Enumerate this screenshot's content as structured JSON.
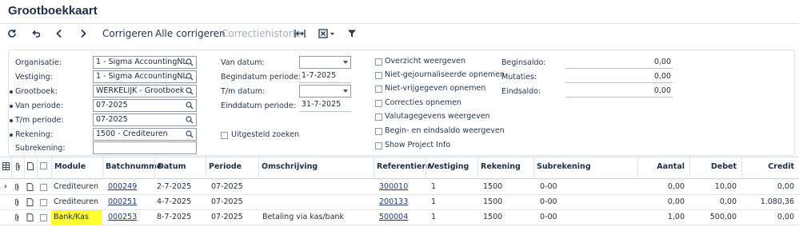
{
  "title": "Grootboekkaart",
  "toolbar": {
    "refresh_icon": "refresh-icon",
    "undo_icon": "undo-icon",
    "prev_icon": "chevron-left-icon",
    "next_icon": "chevron-right-icon",
    "corrigeren": "Corrigeren",
    "alle_corrigeren": "Alle corrigeren",
    "correctiehistorie": "Correctiehistorie",
    "fit_icon": "fit-columns-icon",
    "export_icon": "excel-export-icon",
    "filter_icon": "filter-icon"
  },
  "filter": {
    "organisatie": {
      "label": "Organisatie:",
      "value": "1 - Sigma AccountingNL"
    },
    "vestiging": {
      "label": "Vestiging:",
      "value": "1 - Sigma AccountingNL"
    },
    "grootboek": {
      "label": "Grootboek:",
      "value": "WERKELIJK - Grootboek"
    },
    "van_periode": {
      "label": "Van periode:",
      "value": "07-2025"
    },
    "tm_periode": {
      "label": "T/m periode:",
      "value": "07-2025"
    },
    "rekening": {
      "label": "Rekening:",
      "value": "1500 - Crediteuren"
    },
    "subrekening": {
      "label": "Subrekening:",
      "value": ""
    },
    "van_datum": {
      "label": "Van datum:",
      "value": ""
    },
    "begindatum": {
      "label": "Begindatum periode:",
      "value": "1-7-2025"
    },
    "tm_datum": {
      "label": "T/m datum:",
      "value": ""
    },
    "einddatum": {
      "label": "Einddatum periode:",
      "value": "31-7-2025"
    },
    "uitgesteld": "Uitgesteld zoeken",
    "checks": [
      "Overzicht weergeven",
      "Niet-gejournaliseerde opnemen",
      "Niet-vrijgegeven opnemen",
      "Correcties opnemen",
      "Valutagegevens weergeven",
      "Begin- en eindsaldo weergeven",
      "Show Project Info"
    ],
    "beginsaldo": {
      "label": "Beginsaldo:",
      "value": "0,00"
    },
    "mutaties": {
      "label": "Mutaties:",
      "value": "0,00"
    },
    "eindsaldo": {
      "label": "Eindsaldo:",
      "value": "0,00"
    }
  },
  "grid": {
    "headers": {
      "module": "Module",
      "batch": "Batchnumme",
      "datum": "Datum",
      "periode": "Periode",
      "omschrijving": "Omschrijving",
      "referentie": "Referentienr.",
      "vestiging": "Vestiging",
      "rekening": "Rekening",
      "subrekening": "Subrekening",
      "aantal": "Aantal",
      "debet": "Debet",
      "credit": "Credit"
    },
    "rows": [
      {
        "module": "Crediteuren",
        "batch": "000249",
        "datum": "2-7-2025",
        "periode": "07-2025",
        "omschrijving": "",
        "referentie": "300010",
        "vestiging": "1",
        "rekening": "1500",
        "subrekening": "0-00",
        "aantal": "0,00",
        "debet": "10,00",
        "credit": "0,00"
      },
      {
        "module": "Crediteuren",
        "batch": "000251",
        "datum": "4-7-2025",
        "periode": "07-2025",
        "omschrijving": "",
        "referentie": "200133",
        "vestiging": "1",
        "rekening": "1500",
        "subrekening": "0-00",
        "aantal": "0,00",
        "debet": "0,00",
        "credit": "1.080,36"
      },
      {
        "module": "Bank/Kas",
        "batch": "000253",
        "datum": "8-7-2025",
        "periode": "07-2025",
        "omschrijving": "Betaling via kas/bank",
        "referentie": "500004",
        "vestiging": "1",
        "rekening": "1500",
        "subrekening": "0-00",
        "aantal": "1,00",
        "debet": "500,00",
        "credit": "0,00"
      }
    ]
  },
  "colors": {
    "accent": "#1e3d73",
    "highlight": "#ffff33"
  }
}
